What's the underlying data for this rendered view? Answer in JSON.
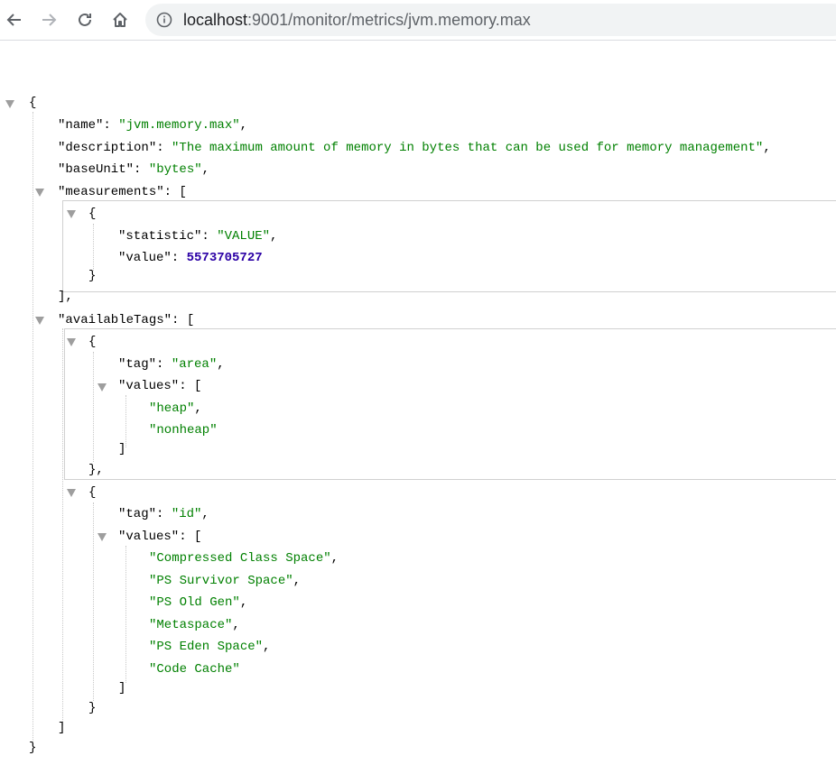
{
  "browser": {
    "url_host": "localhost",
    "url_rest": ":9001/monitor/metrics/jvm.memory.max",
    "icons": [
      "back-arrow-icon",
      "forward-arrow-icon",
      "reload-icon",
      "home-icon",
      "info-icon"
    ]
  },
  "json": {
    "open_brace": "{",
    "name_key": "\"name\": ",
    "name_val": "\"jvm.memory.max\"",
    "description_key": "\"description\": ",
    "description_val": "\"The maximum amount of memory in bytes that can be used for memory management\"",
    "baseUnit_key": "\"baseUnit\": ",
    "baseUnit_val": "\"bytes\"",
    "measurements_key": "\"measurements\": ",
    "measurement": {
      "statistic_key": "\"statistic\": ",
      "statistic_val": "\"VALUE\"",
      "value_key": "\"value\": ",
      "value_val": "5573705727"
    },
    "availableTags_key": "\"availableTags\": ",
    "tag_area": {
      "tag_key": "\"tag\": ",
      "tag_val": "\"area\"",
      "values_key": "\"values\": ",
      "values": [
        "\"heap\"",
        "\"nonheap\""
      ]
    },
    "tag_id": {
      "tag_key": "\"tag\": ",
      "tag_val": "\"id\"",
      "values_key": "\"values\": ",
      "values": [
        "\"Compressed Class Space\"",
        "\"PS Survivor Space\"",
        "\"PS Old Gen\"",
        "\"Metaspace\"",
        "\"PS Eden Space\"",
        "\"Code Cache\""
      ]
    },
    "comma": ",",
    "open_bracket": "[",
    "close_bracket": "]",
    "close_bracket_comma": "],",
    "open_obj": "{",
    "close_obj": "}",
    "close_obj_comma": "},",
    "close_brace": "}"
  }
}
